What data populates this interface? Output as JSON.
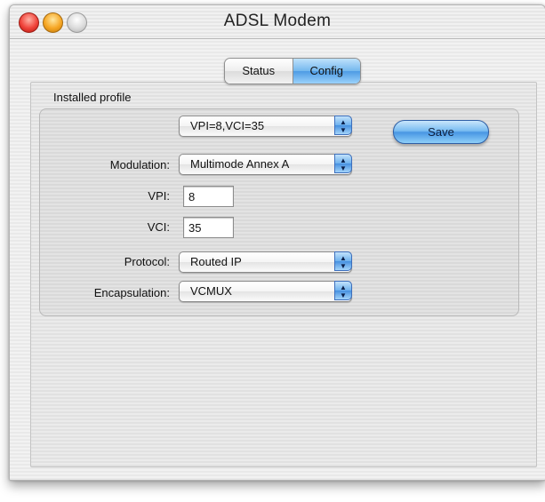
{
  "window": {
    "title": "ADSL Modem"
  },
  "tabs": [
    {
      "label": "Status",
      "active": false
    },
    {
      "label": "Config",
      "active": true
    }
  ],
  "profile": {
    "section_label": "Installed profile",
    "selected": "VPI=8,VCI=35"
  },
  "save_label": "Save",
  "form": {
    "modulation": {
      "label": "Modulation:",
      "value": "Multimode Annex A"
    },
    "vpi": {
      "label": "VPI:",
      "value": "8"
    },
    "vci": {
      "label": "VCI:",
      "value": "35"
    },
    "protocol": {
      "label": "Protocol:",
      "value": "Routed IP"
    },
    "encapsulation": {
      "label": "Encapsulation:",
      "value": "VCMUX"
    }
  },
  "colors": {
    "accent": "#4e9be4",
    "close": "#f0433a",
    "minimize": "#f6a624",
    "zoom": "#dcdcdc"
  }
}
